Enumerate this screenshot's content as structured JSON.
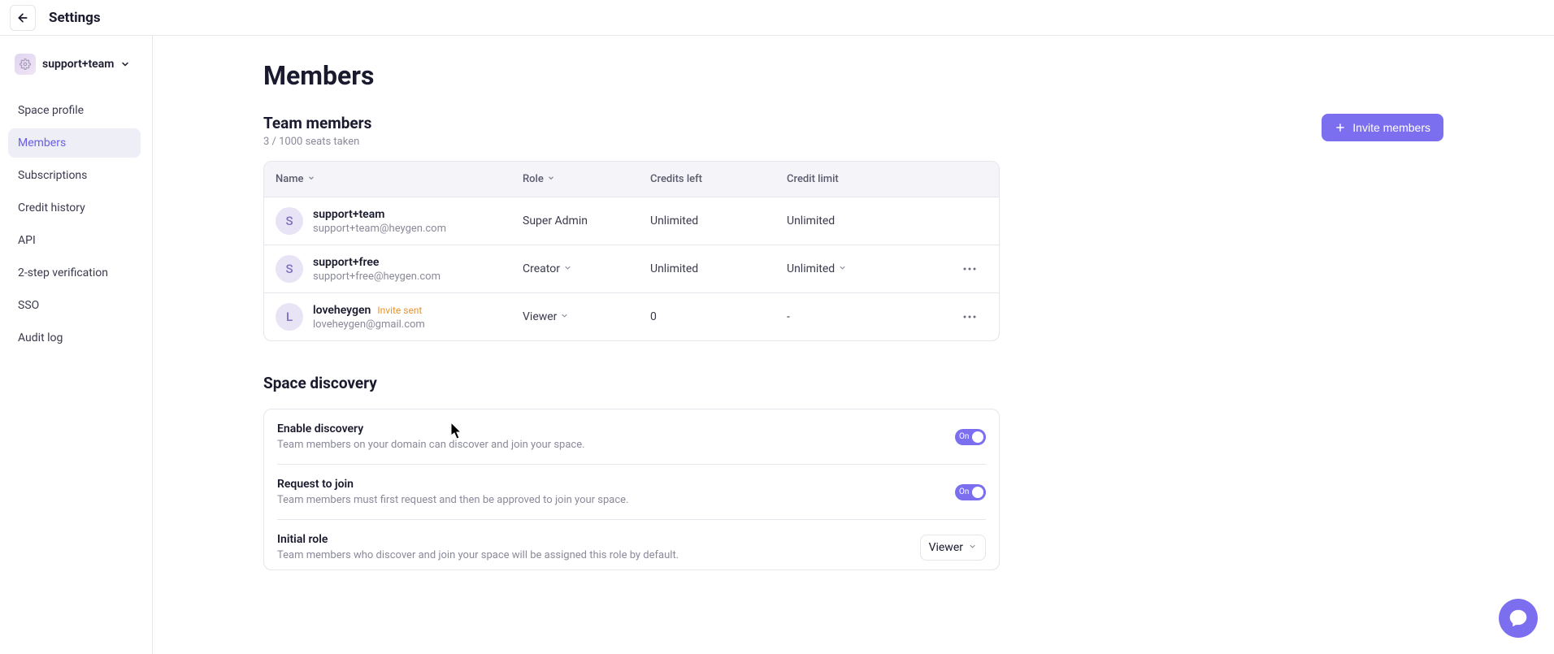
{
  "header": {
    "title": "Settings"
  },
  "sidebar": {
    "team_name": "support+team",
    "items": [
      {
        "label": "Space profile"
      },
      {
        "label": "Members"
      },
      {
        "label": "Subscriptions"
      },
      {
        "label": "Credit history"
      },
      {
        "label": "API"
      },
      {
        "label": "2-step verification"
      },
      {
        "label": "SSO"
      },
      {
        "label": "Audit log"
      }
    ]
  },
  "main": {
    "title": "Members",
    "team_members_heading": "Team members",
    "seats_text": "3 / 1000 seats taken",
    "invite_button": "Invite members",
    "columns": {
      "name": "Name",
      "role": "Role",
      "credits": "Credits left",
      "limit": "Credit limit"
    },
    "members": [
      {
        "avatar": "S",
        "name": "support+team",
        "email": "support+team@heygen.com",
        "role": "Super Admin",
        "role_editable": false,
        "credits": "Unlimited",
        "limit": "Unlimited",
        "limit_editable": false,
        "actions": false,
        "invite_badge": ""
      },
      {
        "avatar": "S",
        "name": "support+free",
        "email": "support+free@heygen.com",
        "role": "Creator",
        "role_editable": true,
        "credits": "Unlimited",
        "limit": "Unlimited",
        "limit_editable": true,
        "actions": true,
        "invite_badge": ""
      },
      {
        "avatar": "L",
        "name": "loveheygen",
        "email": "loveheygen@gmail.com",
        "role": "Viewer",
        "role_editable": true,
        "credits": "0",
        "limit": "-",
        "limit_editable": false,
        "actions": true,
        "invite_badge": "Invite sent"
      }
    ]
  },
  "discovery": {
    "section_title": "Space discovery",
    "rows": [
      {
        "label": "Enable discovery",
        "desc": "Team members on your domain can discover and join your space.",
        "toggle": "On"
      },
      {
        "label": "Request to join",
        "desc": "Team members must first request and then be approved to join your space.",
        "toggle": "On"
      },
      {
        "label": "Initial role",
        "desc": "Team members who discover and join your space will be assigned this role by default.",
        "role": "Viewer"
      }
    ]
  }
}
